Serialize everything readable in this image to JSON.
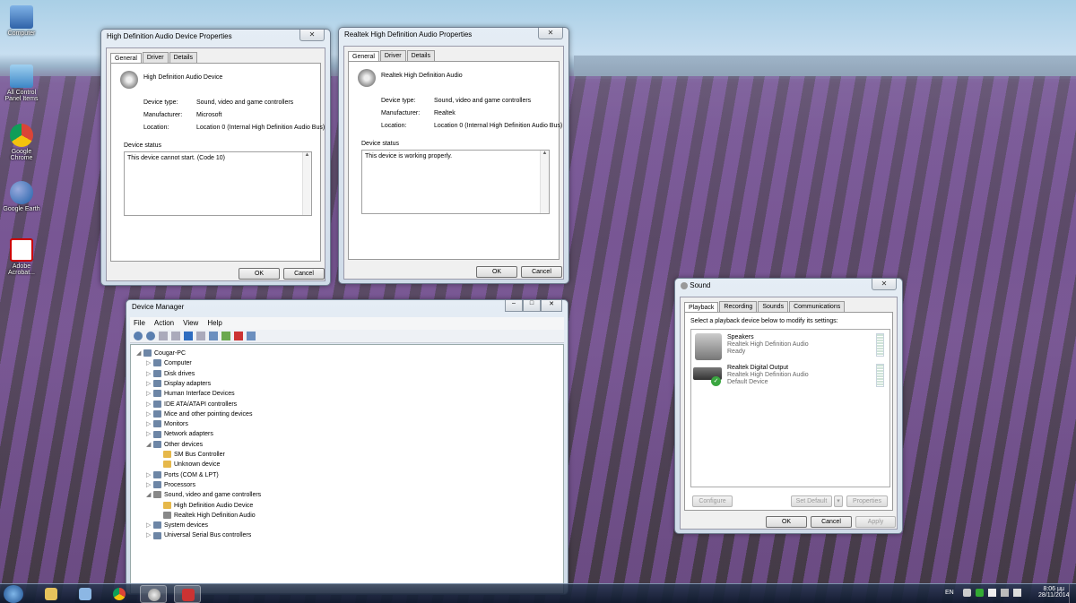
{
  "desktop": {
    "icons": [
      {
        "label": "Computer",
        "icon": "computer-icon"
      },
      {
        "label": "All Control Panel Items",
        "icon": "control-panel-icon"
      },
      {
        "label": "Google Chrome",
        "icon": "chrome-icon"
      },
      {
        "label": "Google Earth",
        "icon": "google-earth-icon"
      },
      {
        "label": "Adobe Acrobat...",
        "icon": "acrobat-icon"
      }
    ]
  },
  "hd_props": {
    "title": "High Definition Audio Device Properties",
    "tabs": [
      "General",
      "Driver",
      "Details"
    ],
    "device_name": "High Definition Audio Device",
    "rows": [
      {
        "label": "Device type:",
        "value": "Sound, video and game controllers"
      },
      {
        "label": "Manufacturer:",
        "value": "Microsoft"
      },
      {
        "label": "Location:",
        "value": "Location 0 (Internal High Definition Audio Bus)"
      }
    ],
    "status_label": "Device status",
    "status_text": "This device cannot start. (Code 10)",
    "ok": "OK",
    "cancel": "Cancel"
  },
  "rt_props": {
    "title": "Realtek High Definition Audio Properties",
    "tabs": [
      "General",
      "Driver",
      "Details"
    ],
    "device_name": "Realtek High Definition Audio",
    "rows": [
      {
        "label": "Device type:",
        "value": "Sound, video and game controllers"
      },
      {
        "label": "Manufacturer:",
        "value": "Realtek"
      },
      {
        "label": "Location:",
        "value": "Location 0 (Internal High Definition Audio Bus)"
      }
    ],
    "status_label": "Device status",
    "status_text": "This device is working properly.",
    "ok": "OK",
    "cancel": "Cancel"
  },
  "devmgr": {
    "title": "Device Manager",
    "menu": [
      "File",
      "Action",
      "View",
      "Help"
    ],
    "tree": [
      {
        "label": "Cougar-PC",
        "level": 0,
        "expanded": true,
        "icon": "pc-icon"
      },
      {
        "label": "Computer",
        "level": 1,
        "icon": "computer-icon"
      },
      {
        "label": "Disk drives",
        "level": 1,
        "icon": "disk-drive-icon"
      },
      {
        "label": "Display adapters",
        "level": 1,
        "icon": "display-adapter-icon"
      },
      {
        "label": "Human Interface Devices",
        "level": 1,
        "icon": "hid-icon"
      },
      {
        "label": "IDE ATA/ATAPI controllers",
        "level": 1,
        "icon": "ide-controller-icon"
      },
      {
        "label": "Mice and other pointing devices",
        "level": 1,
        "icon": "mouse-icon"
      },
      {
        "label": "Monitors",
        "level": 1,
        "icon": "monitor-icon"
      },
      {
        "label": "Network adapters",
        "level": 1,
        "icon": "network-adapter-icon"
      },
      {
        "label": "Other devices",
        "level": 1,
        "expanded": true,
        "icon": "other-devices-icon"
      },
      {
        "label": "SM Bus Controller",
        "level": 2,
        "icon": "warning-device-icon"
      },
      {
        "label": "Unknown device",
        "level": 2,
        "icon": "warning-device-icon"
      },
      {
        "label": "Ports (COM & LPT)",
        "level": 1,
        "icon": "port-icon"
      },
      {
        "label": "Processors",
        "level": 1,
        "icon": "processor-icon"
      },
      {
        "label": "Sound, video and game controllers",
        "level": 1,
        "expanded": true,
        "icon": "speaker-icon"
      },
      {
        "label": "High Definition Audio Device",
        "level": 2,
        "icon": "warning-speaker-icon"
      },
      {
        "label": "Realtek High Definition Audio",
        "level": 2,
        "icon": "speaker-icon"
      },
      {
        "label": "System devices",
        "level": 1,
        "icon": "system-device-icon"
      },
      {
        "label": "Universal Serial Bus controllers",
        "level": 1,
        "icon": "usb-icon"
      }
    ]
  },
  "sound": {
    "title": "Sound",
    "tabs": [
      "Playback",
      "Recording",
      "Sounds",
      "Communications"
    ],
    "instruction": "Select a playback device below to modify its settings:",
    "devices": [
      {
        "name": "Speakers",
        "driver": "Realtek High Definition Audio",
        "status": "Ready"
      },
      {
        "name": "Realtek Digital Output",
        "driver": "Realtek High Definition Audio",
        "status": "Default Device"
      }
    ],
    "configure": "Configure",
    "set_default": "Set Default",
    "properties": "Properties",
    "ok": "OK",
    "cancel": "Cancel",
    "apply": "Apply"
  },
  "taskbar": {
    "lang": "EN",
    "time": "8:06 μμ",
    "date": "28/11/2014"
  }
}
